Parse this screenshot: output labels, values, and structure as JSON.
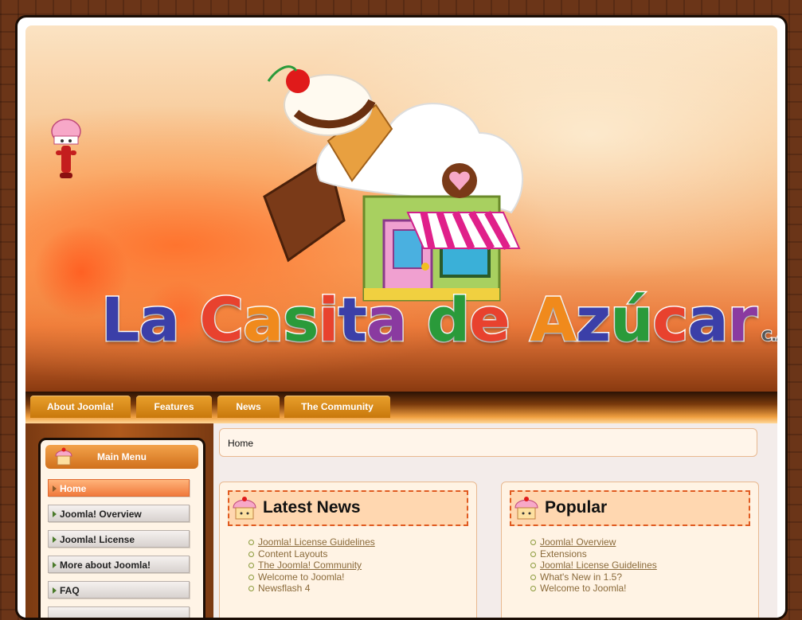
{
  "brand": {
    "logo_text": "La Casita de Azúcar",
    "logo_suffix": "C.A."
  },
  "nav": [
    {
      "label": "About Joomla!"
    },
    {
      "label": "Features"
    },
    {
      "label": "News"
    },
    {
      "label": "The Community"
    }
  ],
  "sidebar": {
    "title": "Main Menu",
    "items": [
      {
        "label": "Home",
        "active": true
      },
      {
        "label": "Joomla! Overview"
      },
      {
        "label": "Joomla! License"
      },
      {
        "label": "More about Joomla!"
      },
      {
        "label": "FAQ"
      }
    ]
  },
  "breadcrumb": "Home",
  "modules": [
    {
      "title": "Latest News",
      "items": [
        {
          "label": "Joomla! License Guidelines",
          "link": true
        },
        {
          "label": "Content Layouts",
          "link": false
        },
        {
          "label": "The Joomla! Community",
          "link": true
        },
        {
          "label": "Welcome to Joomla!",
          "link": false
        },
        {
          "label": "Newsflash 4",
          "link": false
        }
      ]
    },
    {
      "title": "Popular",
      "items": [
        {
          "label": "Joomla! Overview",
          "link": true
        },
        {
          "label": "Extensions",
          "link": false
        },
        {
          "label": "Joomla! License Guidelines",
          "link": true
        },
        {
          "label": "What's New in 1.5?",
          "link": false
        },
        {
          "label": "Welcome to Joomla!",
          "link": false
        }
      ]
    }
  ],
  "colors": {
    "logo_letters": [
      "#3b3fa8",
      "#3b3fa8",
      "#e8422e",
      "#f08a1c",
      "#2a9a3a",
      "#e8422e",
      "#3b3fa8",
      "#8a3aa0",
      "#2a9a3a",
      "#e8422e",
      "#f08a1c",
      "#3b3fa8",
      "#2a9a3a",
      "#e8422e",
      "#3b3fa8",
      "#8a3aa0",
      "#f08a1c",
      "#3b3fa8",
      "#e8422e"
    ]
  }
}
